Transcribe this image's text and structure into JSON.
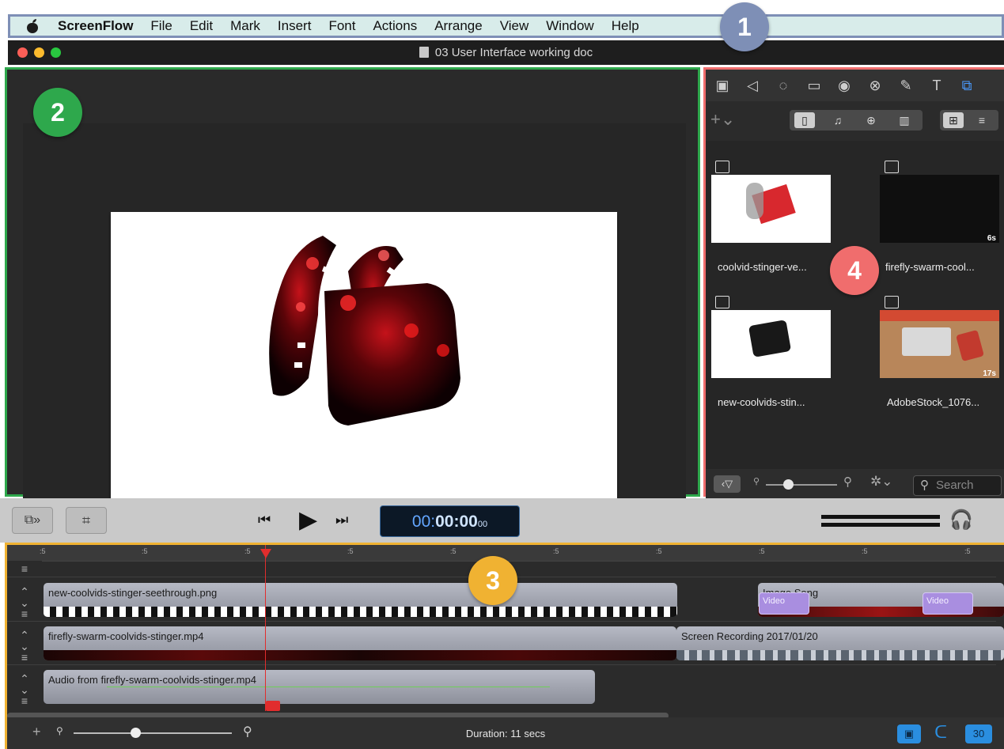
{
  "menubar": {
    "app": "ScreenFlow",
    "items": [
      "File",
      "Edit",
      "Mark",
      "Insert",
      "Font",
      "Actions",
      "Arrange",
      "View",
      "Window",
      "Help"
    ]
  },
  "window": {
    "title": "03 User Interface working doc"
  },
  "callouts": {
    "menubar": "1",
    "canvas": "2",
    "timeline": "3",
    "media": "4"
  },
  "colors": {
    "menubar_callout": "#7e8fb6",
    "canvas_callout": "#2ea84c",
    "timeline_callout": "#f0b232",
    "media_callout": "#f06d6d"
  },
  "right_panel": {
    "toolbar_icons": [
      "video-properties-icon",
      "audio-properties-icon",
      "video-motion-icon",
      "screen-recording-icon",
      "callout-icon",
      "touch-callout-icon",
      "annotations-icon",
      "text-icon",
      "media-library-icon"
    ],
    "media": [
      {
        "name": "coolvid-stinger-ve...",
        "type": "image",
        "badge": "∞"
      },
      {
        "name": "firefly-swarm-cool...",
        "type": "video",
        "badge": "6s"
      },
      {
        "name": "new-coolvids-stin...",
        "type": "image",
        "badge": "∞"
      },
      {
        "name": "AdobeStock_1076...",
        "type": "video",
        "badge": "17s"
      }
    ],
    "search_placeholder": "Search"
  },
  "transport": {
    "timecode_main": "00:",
    "timecode_bold": "00:00",
    "timecode_frames": "00"
  },
  "timeline": {
    "ruler_labels": [
      ":5",
      ":5",
      ":5",
      ":5",
      ":5",
      ":5",
      ":5",
      ":5",
      ":5",
      ":5"
    ],
    "clips": {
      "track1": "new-coolvids-stinger-seethrough.png",
      "track1_right": "Image Song",
      "track2": "firefly-swarm-coolvids-stinger.mp4",
      "track2_right": "Screen Recording 2017/01/20",
      "track3": "Audio from firefly-swarm-coolvids-stinger.mp4",
      "video_tag": "Video"
    },
    "duration": "Duration: 11 secs",
    "fps": "30"
  }
}
